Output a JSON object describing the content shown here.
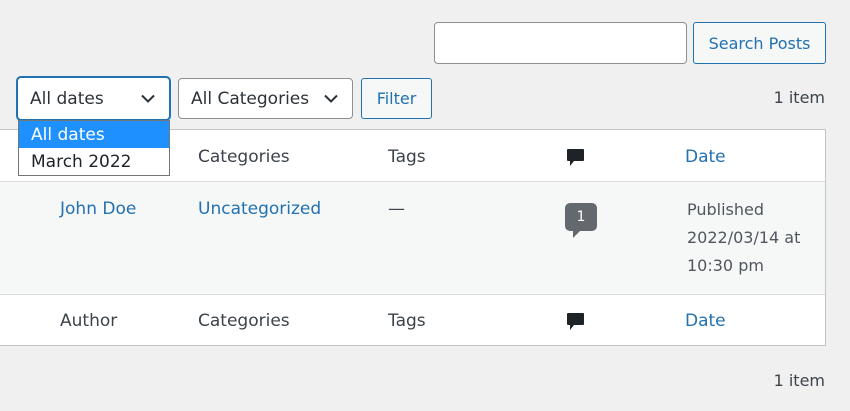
{
  "search": {
    "button_label": "Search Posts",
    "value": ""
  },
  "filters": {
    "date_selected": "All dates",
    "date_options": [
      "All dates",
      "March 2022"
    ],
    "category_selected": "All Categories",
    "filter_label": "Filter"
  },
  "item_count": "1 item",
  "table": {
    "header": {
      "categories": "Categories",
      "tags": "Tags",
      "date": "Date"
    },
    "row": {
      "author": "John Doe",
      "categories": "Uncategorized",
      "tags": "—",
      "comments": "1",
      "date_status": "Published",
      "date_value": "2022/03/14 at",
      "date_time": "10:30 pm"
    },
    "footer": {
      "author": "Author",
      "categories": "Categories",
      "tags": "Tags",
      "date": "Date"
    }
  },
  "colors": {
    "accent": "#2271b1",
    "dropdown_highlight": "#1e90ff",
    "badge": "#646970"
  },
  "icons": {
    "comments": "comment-bubble-icon",
    "chevron": "chevron-down-icon"
  }
}
